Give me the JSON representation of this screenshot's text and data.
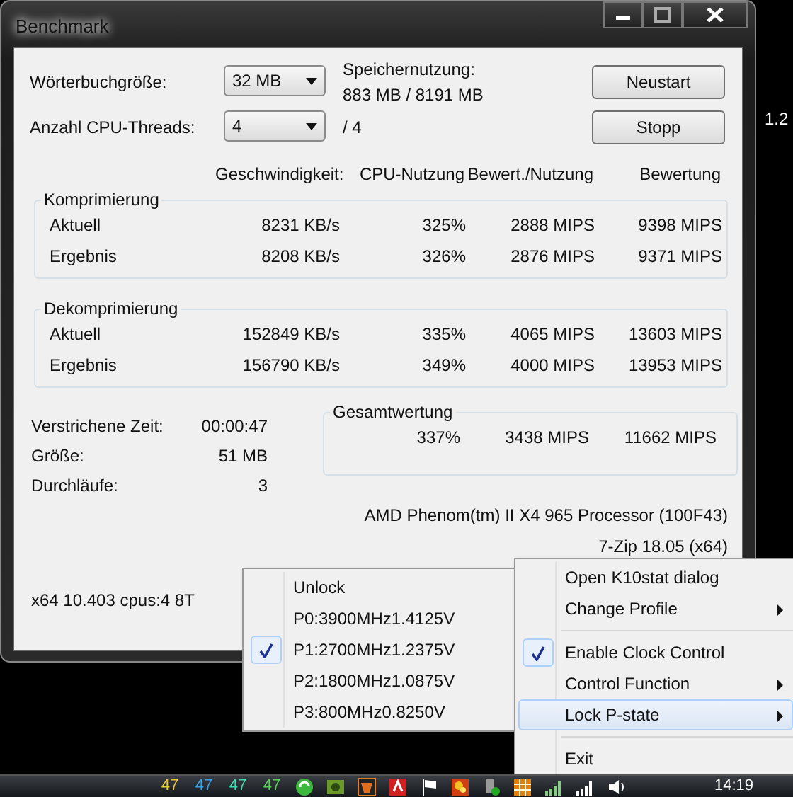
{
  "window": {
    "title": "Benchmark"
  },
  "settings": [
    {
      "label": "Wörterbuchgröße:",
      "value": "32 MB"
    },
    {
      "label": "Anzahl CPU-Threads:",
      "value": "4"
    }
  ],
  "memory": {
    "label": "Speichernutzung:",
    "value": "883 MB / 8191 MB"
  },
  "threads_total": "/ 4",
  "buttons": [
    "Neustart",
    "Stopp"
  ],
  "columns": [
    "Geschwindigkeit:",
    "CPU-Nutzung",
    "Bewert./Nutzung",
    "Bewertung"
  ],
  "groups": [
    {
      "title": "Komprimierung",
      "rows": [
        {
          "label": "Aktuell",
          "values": [
            "8231 KB/s",
            "325%",
            "2888 MIPS",
            "9398 MIPS"
          ]
        },
        {
          "label": "Ergebnis",
          "values": [
            "8208 KB/s",
            "326%",
            "2876 MIPS",
            "9371 MIPS"
          ]
        }
      ]
    },
    {
      "title": "Dekomprimierung",
      "rows": [
        {
          "label": "Aktuell",
          "values": [
            "152849 KB/s",
            "335%",
            "4065 MIPS",
            "13603 MIPS"
          ]
        },
        {
          "label": "Ergebnis",
          "values": [
            "156790 KB/s",
            "349%",
            "4000 MIPS",
            "13953 MIPS"
          ]
        }
      ]
    }
  ],
  "stats": [
    {
      "label": "Verstrichene Zeit:",
      "value": "00:00:47"
    },
    {
      "label": "Größe:",
      "value": "51 MB"
    },
    {
      "label": "Durchläufe:",
      "value": "3"
    }
  ],
  "total": {
    "title": "Gesamtwertung",
    "values": [
      "337%",
      "3438 MIPS",
      "11662 MIPS"
    ]
  },
  "processor": "AMD Phenom(tm) II X4 965 Processor (100F43)",
  "version": "7-Zip 18.05 (x64)",
  "system_info": "x64 10.403 cpus:4 8T",
  "desktop_text": "1.2",
  "submenu": {
    "items": [
      {
        "kind": "item",
        "label": "Unlock",
        "checked": false
      },
      {
        "kind": "item",
        "label": "P0:3900MHz1.4125V",
        "checked": false
      },
      {
        "kind": "item",
        "label": "P1:2700MHz1.2375V",
        "checked": true
      },
      {
        "kind": "item",
        "label": "P2:1800MHz1.0875V",
        "checked": false
      },
      {
        "kind": "item",
        "label": "P3:800MHz0.8250V",
        "checked": false
      }
    ]
  },
  "context_menu": {
    "items": [
      {
        "kind": "item",
        "label": "Open K10stat dialog",
        "checked": false,
        "has_submenu": false,
        "selected": false
      },
      {
        "kind": "item",
        "label": "Change Profile",
        "checked": false,
        "has_submenu": true,
        "selected": false
      },
      {
        "kind": "separator"
      },
      {
        "kind": "item",
        "label": "Enable Clock Control",
        "checked": true,
        "has_submenu": false,
        "selected": false
      },
      {
        "kind": "item",
        "label": "Control Function",
        "checked": false,
        "has_submenu": true,
        "selected": false
      },
      {
        "kind": "item",
        "label": "Lock P-state",
        "checked": false,
        "has_submenu": true,
        "selected": true
      },
      {
        "kind": "separator"
      },
      {
        "kind": "item",
        "label": "Exit",
        "checked": false,
        "has_submenu": false,
        "selected": false
      }
    ]
  },
  "taskbar": {
    "tray_readings": [
      {
        "text": "47",
        "color": "#e8c838"
      },
      {
        "text": "47",
        "color": "#3aa0e8"
      },
      {
        "text": "47",
        "color": "#40d8b0"
      },
      {
        "text": "47",
        "color": "#58d058"
      }
    ],
    "clock": "14:19"
  }
}
